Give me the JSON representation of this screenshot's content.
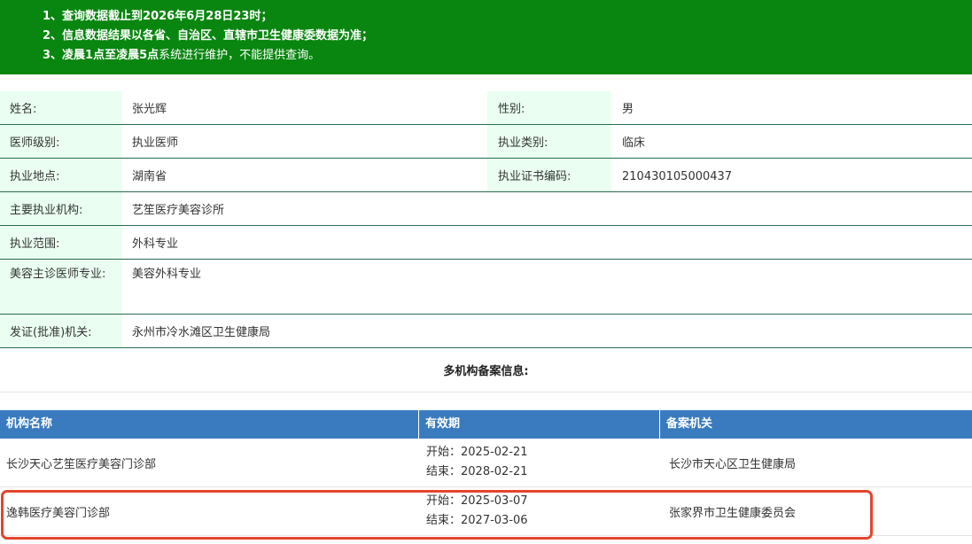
{
  "notice": {
    "line1_prefix": "1、查询数据截止到",
    "line1_date": "2026年6月28日23时",
    "line1_suffix": "；",
    "line2": "2、信息数据结果以各省、自治区、直辖市卫生健康委数据为准；",
    "line3_prefix": "3、",
    "line3_bold": "凌晨1点至凌晨5点",
    "line3_suffix": "系统进行维护，不能提供查询。"
  },
  "info": {
    "name_label": "姓名:",
    "name_value": "张光辉",
    "gender_label": "性别:",
    "gender_value": "男",
    "level_label": "医师级别:",
    "level_value": "执业医师",
    "category_label": "执业类别:",
    "category_value": "临床",
    "location_label": "执业地点:",
    "location_value": "湖南省",
    "cert_label": "执业证书编码:",
    "cert_value": "210430105000437",
    "org_label": "主要执业机构:",
    "org_value": "艺笙医疗美容诊所",
    "scope_label": "执业范围:",
    "scope_value": "外科专业",
    "beauty_label": "美容主诊医师专业:",
    "beauty_value": "美容外科专业",
    "issuer_label": "发证(批准)机关:",
    "issuer_value": "永州市冷水滩区卫生健康局"
  },
  "multi_title": "多机构备案信息:",
  "table": {
    "headers": [
      "机构名称",
      "有效期",
      "备案机关"
    ],
    "rows": [
      {
        "name": "长沙天心艺笙医疗美容门诊部",
        "start": "开始：2025-02-21",
        "end": "结束：2028-02-21",
        "agency": "长沙市天心区卫生健康局"
      },
      {
        "name": "逸韩医疗美容门诊部",
        "start": "开始：2025-03-07",
        "end": "结束：2027-03-06",
        "agency": "张家界市卫生健康委员会"
      }
    ]
  },
  "colors": {
    "notice_bg": "#08860f",
    "header_bg": "#3a7bbf",
    "label_bg": "#eafff1",
    "highlight": "#e4452e"
  }
}
